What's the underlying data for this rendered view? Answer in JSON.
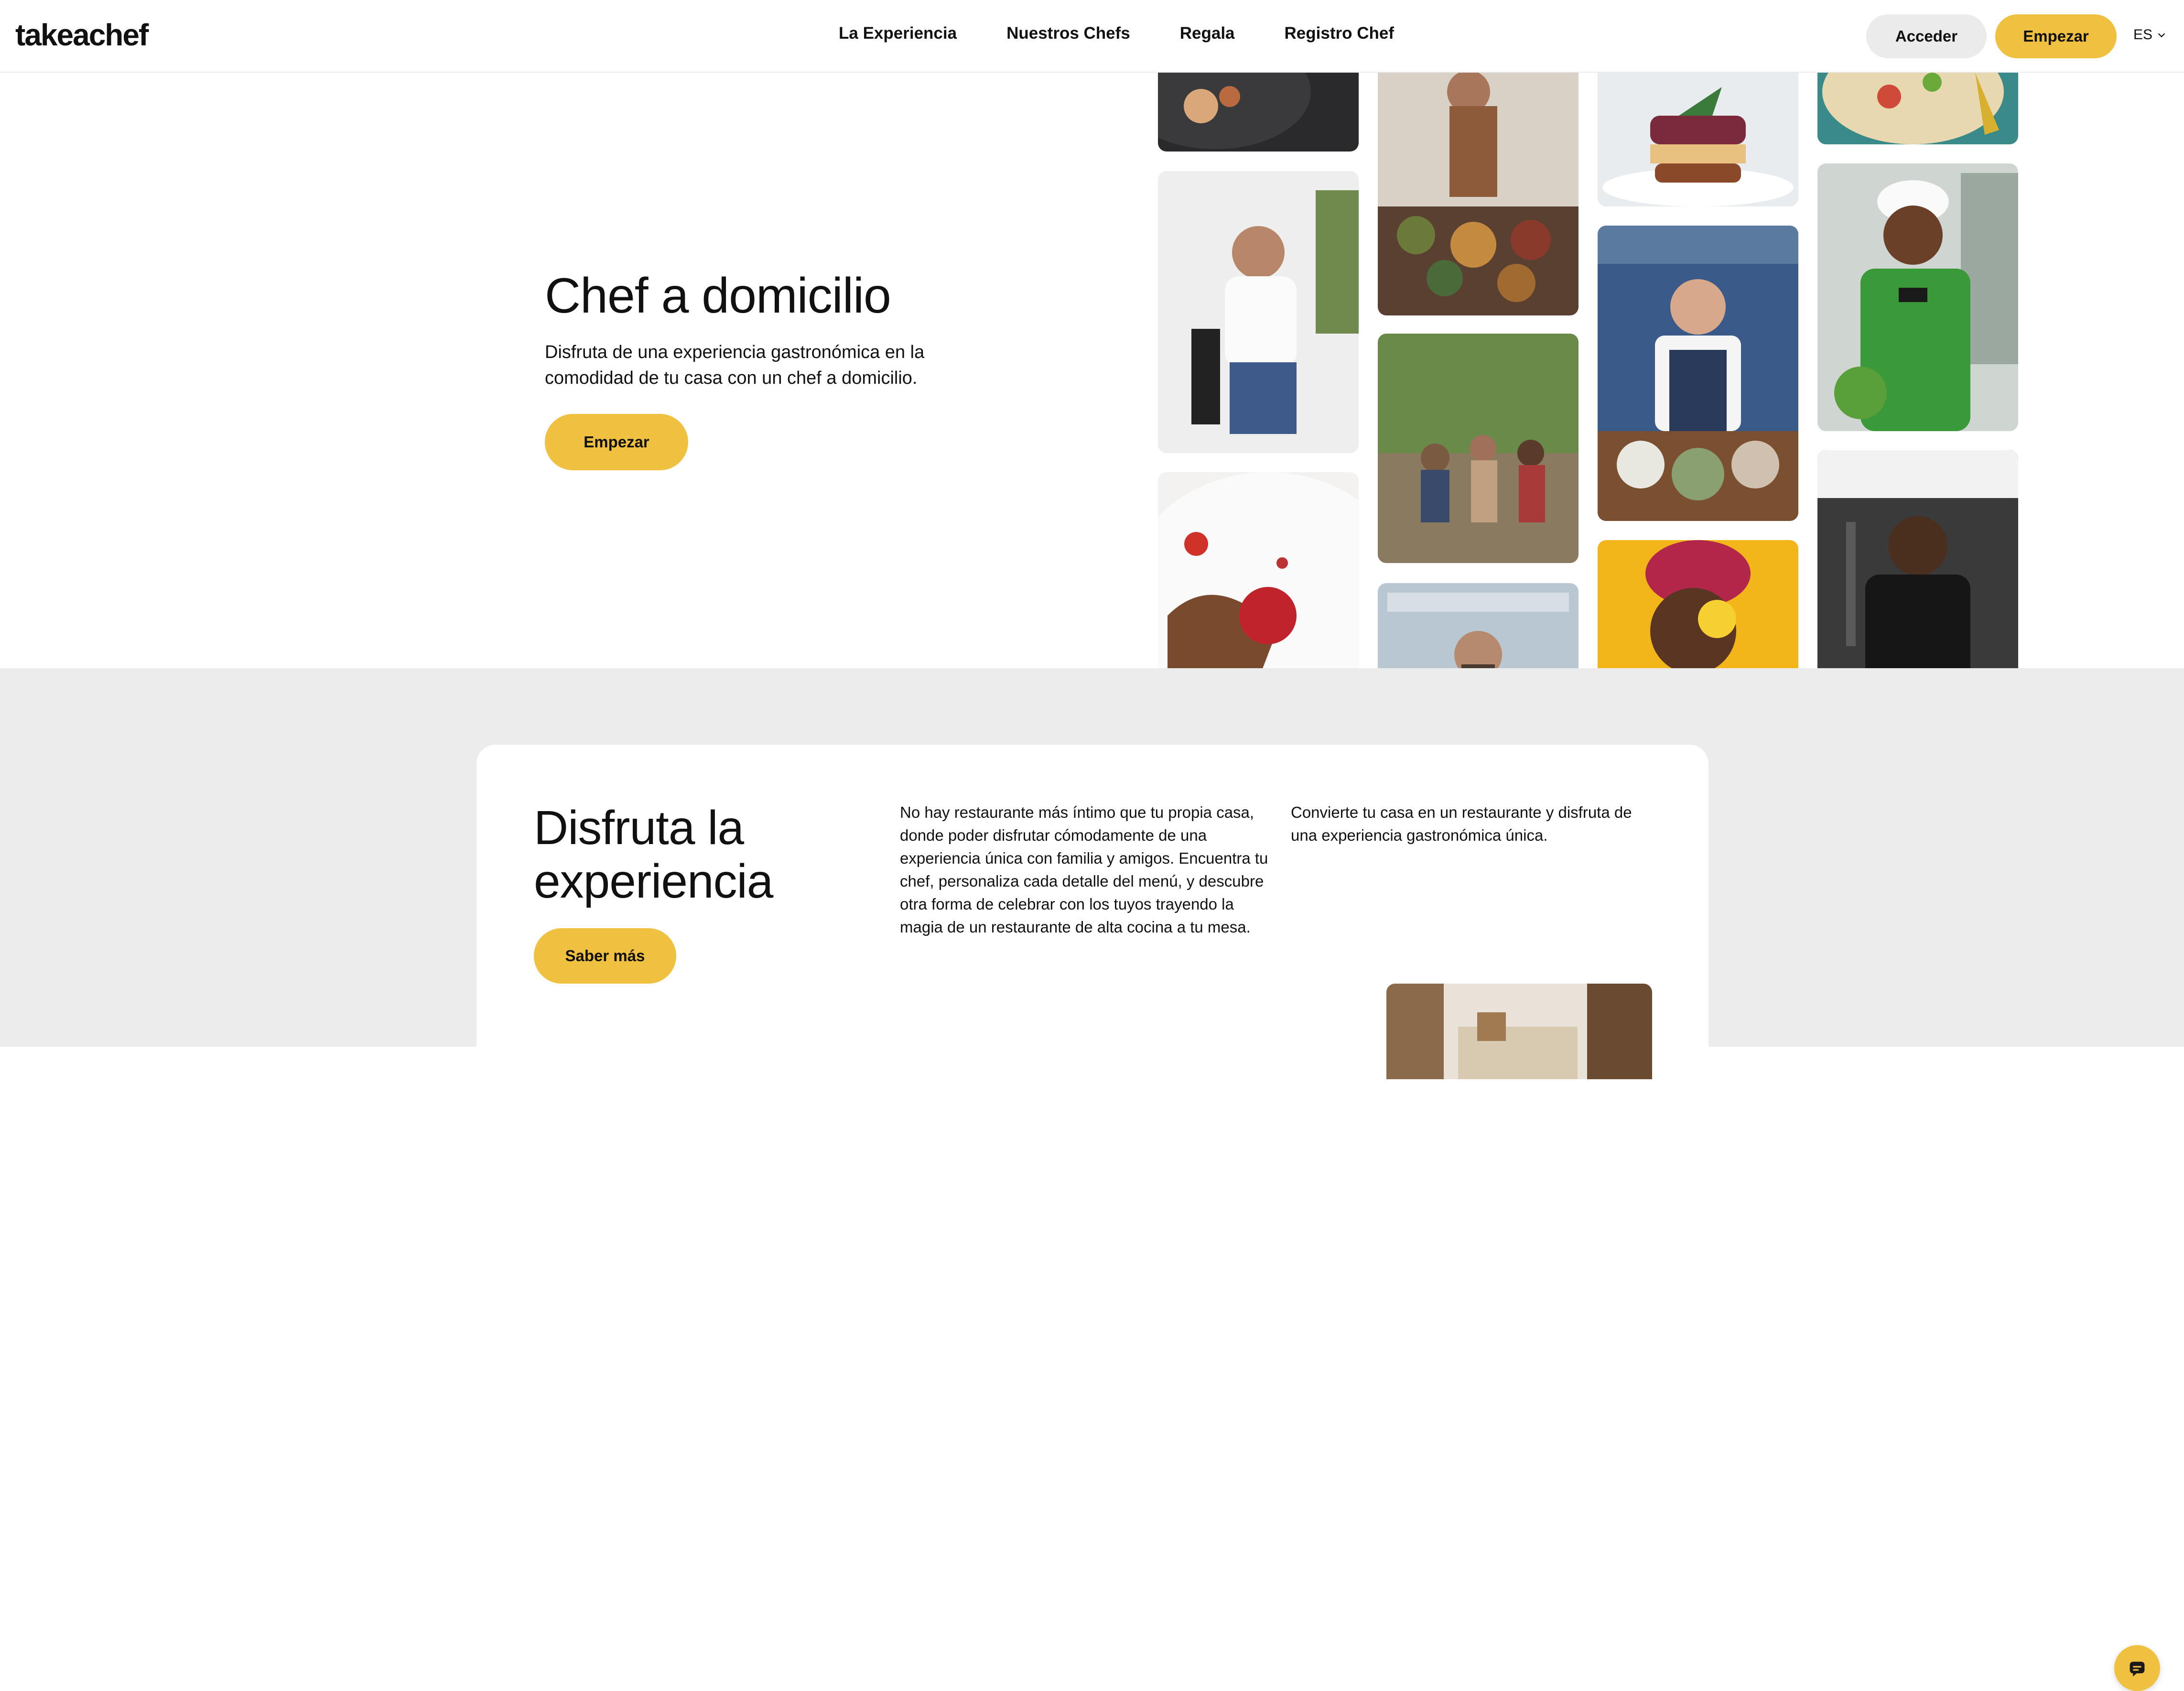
{
  "header": {
    "logo": "takeachef",
    "nav": [
      "La Experiencia",
      "Nuestros Chefs",
      "Regala",
      "Registro Chef"
    ],
    "login_label": "Acceder",
    "start_label": "Empezar",
    "language": "ES"
  },
  "hero": {
    "title": "Chef a domicilio",
    "text": "Disfruta de una experiencia gastronómica en la comodidad de tu casa con un chef a domicilio.",
    "button": "Empezar"
  },
  "experience": {
    "title": "Disfruta la experiencia",
    "button": "Saber más",
    "paragraph_1": "No hay restaurante más íntimo que tu propia casa, donde poder disfrutar cómodamente de una experiencia única con familia y amigos. Encuentra tu chef, personaliza cada detalle del menú, y descubre otra forma de celebrar con los tuyos trayendo la magia de un restaurante de alta cocina a tu mesa.",
    "paragraph_2": "Convierte tu casa en un restaurante y disfruta de una experiencia gastronómica única."
  },
  "colors": {
    "accent": "#f0c140",
    "background_gray": "#ececec",
    "text": "#111111"
  },
  "icons": {
    "language_chevron": "chevron-down-icon",
    "chat": "chat-icon"
  }
}
